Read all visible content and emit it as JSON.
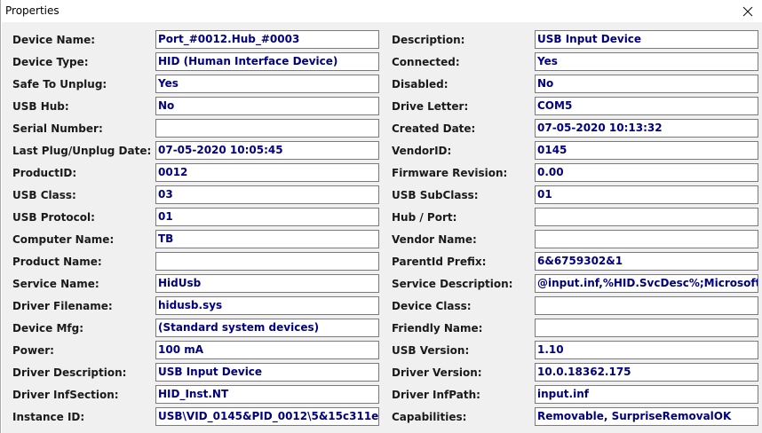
{
  "window": {
    "title": "Properties"
  },
  "rows": [
    {
      "left_label": "Device Name:",
      "left_value": "Port_#0012.Hub_#0003",
      "right_label": "Description:",
      "right_value": "USB Input Device"
    },
    {
      "left_label": "Device Type:",
      "left_value": "HID (Human Interface Device)",
      "right_label": "Connected:",
      "right_value": "Yes"
    },
    {
      "left_label": "Safe To Unplug:",
      "left_value": "Yes",
      "right_label": "Disabled:",
      "right_value": "No"
    },
    {
      "left_label": "USB Hub:",
      "left_value": "No",
      "right_label": "Drive Letter:",
      "right_value": "COM5"
    },
    {
      "left_label": "Serial Number:",
      "left_value": "",
      "right_label": "Created Date:",
      "right_value": "07-05-2020 10:13:32"
    },
    {
      "left_label": "Last Plug/Unplug Date:",
      "left_value": "07-05-2020 10:05:45",
      "right_label": "VendorID:",
      "right_value": "0145"
    },
    {
      "left_label": "ProductID:",
      "left_value": "0012",
      "right_label": "Firmware Revision:",
      "right_value": "0.00"
    },
    {
      "left_label": "USB Class:",
      "left_value": "03",
      "right_label": "USB SubClass:",
      "right_value": "01"
    },
    {
      "left_label": "USB Protocol:",
      "left_value": "01",
      "right_label": "Hub / Port:",
      "right_value": ""
    },
    {
      "left_label": "Computer Name:",
      "left_value": "TB",
      "right_label": "Vendor Name:",
      "right_value": ""
    },
    {
      "left_label": "Product Name:",
      "left_value": "",
      "right_label": "ParentId Prefix:",
      "right_value": "6&6759302&1"
    },
    {
      "left_label": "Service Name:",
      "left_value": "HidUsb",
      "right_label": "Service Description:",
      "right_value": "@input.inf,%HID.SvcDesc%;Microsoft"
    },
    {
      "left_label": "Driver Filename:",
      "left_value": "hidusb.sys",
      "right_label": "Device Class:",
      "right_value": ""
    },
    {
      "left_label": "Device Mfg:",
      "left_value": "(Standard system devices)",
      "right_label": "Friendly Name:",
      "right_value": ""
    },
    {
      "left_label": "Power:",
      "left_value": "100 mA",
      "right_label": "USB Version:",
      "right_value": "1.10"
    },
    {
      "left_label": "Driver Description:",
      "left_value": "USB Input Device",
      "right_label": "Driver Version:",
      "right_value": "10.0.18362.175"
    },
    {
      "left_label": "Driver InfSection:",
      "left_value": "HID_Inst.NT",
      "right_label": "Driver InfPath:",
      "right_value": "input.inf"
    },
    {
      "left_label": "Instance ID:",
      "left_value": "USB\\VID_0145&PID_0012\\5&15c311e",
      "right_label": "Capabilities:",
      "right_value": "Removable, SurpriseRemovalOK"
    }
  ],
  "colors": {
    "value_text": "#000080",
    "label_text": "#1a1a1a",
    "client_bg": "#f0f0f0"
  },
  "icons": {
    "close": "close-icon"
  }
}
